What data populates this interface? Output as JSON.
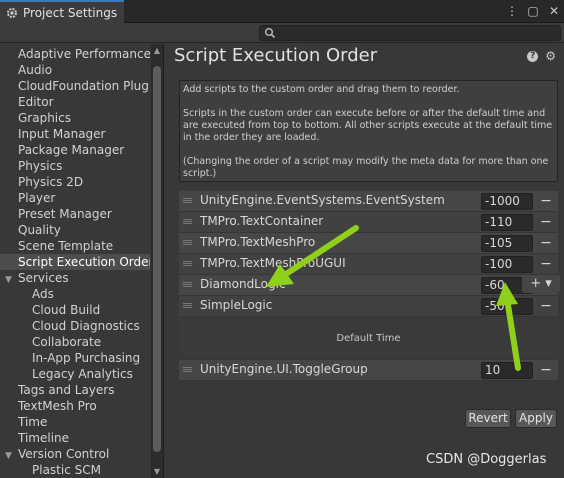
{
  "window": {
    "tab_title": "Project Settings",
    "controls": [
      "⋮",
      "▢",
      "✕"
    ]
  },
  "search": {
    "placeholder": ""
  },
  "sidebar": {
    "items": [
      "Adaptive Performance",
      "Audio",
      "CloudFoundation Plugin",
      "Editor",
      "Graphics",
      "Input Manager",
      "Package Manager",
      "Physics",
      "Physics 2D",
      "Player",
      "Preset Manager",
      "Quality",
      "Scene Template",
      "Script Execution Order",
      "Services",
      "Ads",
      "Cloud Build",
      "Cloud Diagnostics",
      "Collaborate",
      "In-App Purchasing",
      "Legacy Analytics",
      "Tags and Layers",
      "TextMesh Pro",
      "Time",
      "Timeline",
      "Version Control",
      "Plastic SCM"
    ],
    "selected": "Script Execution Order"
  },
  "main": {
    "title": "Script Execution Order",
    "help": {
      "p1": "Add scripts to the custom order and drag them to reorder.",
      "p2": "Scripts in the custom order can execute before or after the default time and are executed from top to bottom. All other scripts execute at the default time in the order they are loaded.",
      "p3": "(Changing the order of a script may modify the meta data for more than one script.)"
    },
    "rows_before": [
      {
        "name": "UnityEngine.EventSystems.EventSystem",
        "value": "-1000"
      },
      {
        "name": "TMPro.TextContainer",
        "value": "-110"
      },
      {
        "name": "TMPro.TextMeshPro",
        "value": "-105"
      },
      {
        "name": "TMPro.TextMeshProUGUI",
        "value": "-100"
      },
      {
        "name": "DiamondLogic",
        "value": "-60"
      },
      {
        "name": "SimpleLogic",
        "value": "-50"
      }
    ],
    "default_time_label": "Default Time",
    "rows_after": [
      {
        "name": "UnityEngine.UI.ToggleGroup",
        "value": "10"
      }
    ],
    "add_button": "+ ▾",
    "remove_glyph": "−",
    "revert_label": "Revert",
    "apply_label": "Apply"
  },
  "watermark": "CSDN @Doggerlas",
  "colors": {
    "accent": "#3a79bb",
    "annotation_arrow": "#8fd11a"
  }
}
